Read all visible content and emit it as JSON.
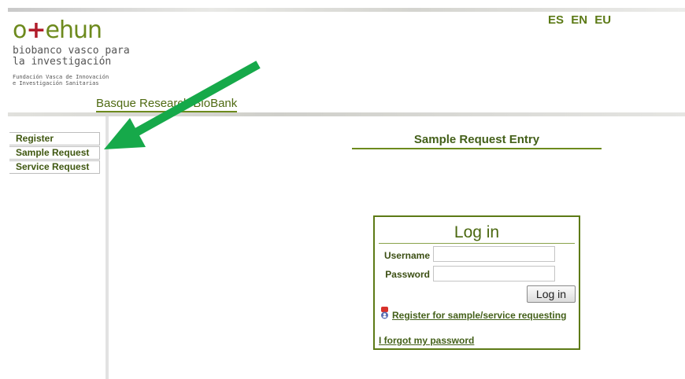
{
  "header": {
    "logo_left": "o",
    "logo_plus": "+",
    "logo_right": "ehun",
    "logo_sub_line1": "biobanco vasco para",
    "logo_sub_line2": "la investigación",
    "logo_small_line1": "Fundación Vasca de Innovación",
    "logo_small_line2": "e Investigación Sanitarias",
    "brand": "Basque Research BioBank",
    "languages": [
      "ES",
      "EN",
      "EU"
    ]
  },
  "sidebar": {
    "items": [
      {
        "label": "Register"
      },
      {
        "label": "Sample Request"
      },
      {
        "label": "Service Request"
      }
    ]
  },
  "main": {
    "title": "Sample Request Entry"
  },
  "login": {
    "title": "Log in",
    "username_label": "Username",
    "username_value": "",
    "password_label": "Password",
    "password_value": "",
    "submit_label": "Log in",
    "register_link": "Register for sample/service requesting",
    "forgot_link": "I forgot my password"
  },
  "colors": {
    "brand_green": "#6d8a1d",
    "arrow_green": "#16a94a"
  }
}
